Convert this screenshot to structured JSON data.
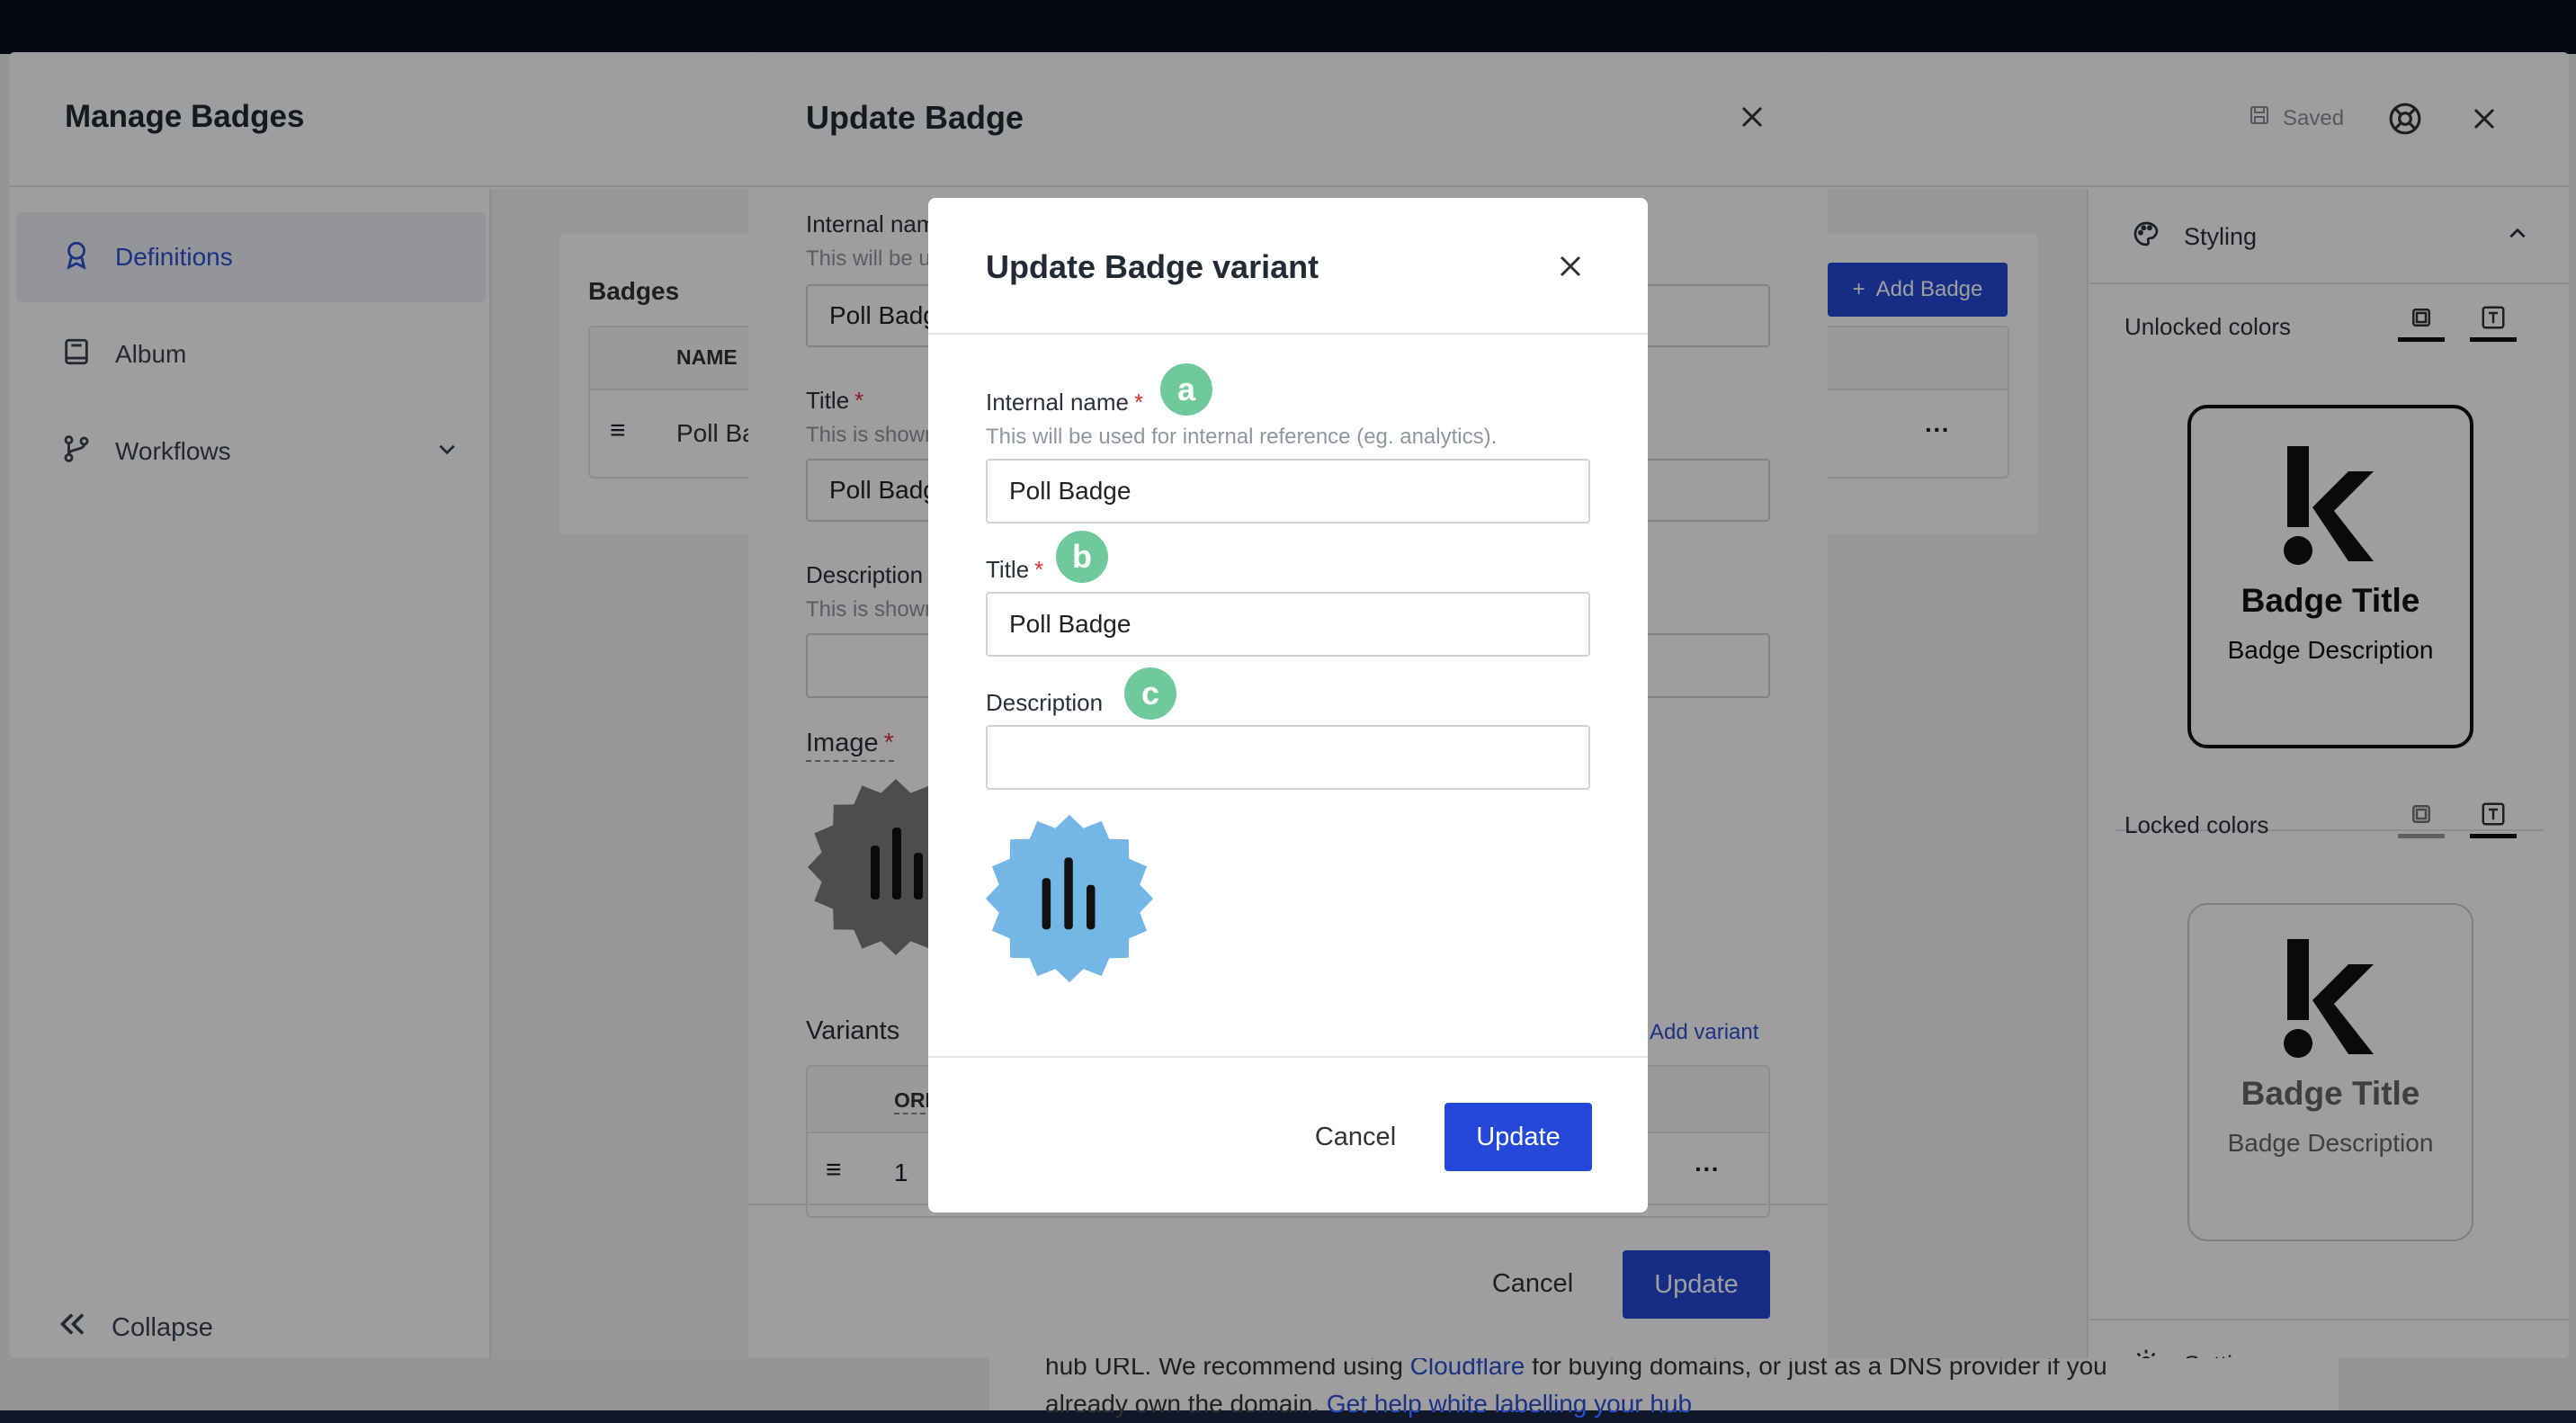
{
  "background": {
    "doc_line1_prefix": "hub URL. We recommend using ",
    "doc_link1": "Cloudflare",
    "doc_line1_suffix": " for buying domains, or just as a DNS provider if you",
    "doc_line2_prefix": "already own the domain. ",
    "doc_link2": "Get help white labelling your hub"
  },
  "manage": {
    "title": "Manage Badges",
    "saved_label": "Saved",
    "sidebar": {
      "items": [
        {
          "label": "Definitions",
          "icon": "badge-icon",
          "active": true
        },
        {
          "label": "Album",
          "icon": "book-icon",
          "active": false
        },
        {
          "label": "Workflows",
          "icon": "workflow-icon",
          "active": false
        }
      ],
      "collapse_label": "Collapse"
    },
    "badges_card": {
      "title": "Badges",
      "add_label": "Add Badge",
      "col_name": "NAME",
      "row_name": "Poll Badge",
      "row_more": "···"
    },
    "right_panel": {
      "styling_label": "Styling",
      "unlocked_label": "Unlocked colors",
      "locked_label": "Locked colors",
      "settings_label": "Settings",
      "preview_title": "Badge Title",
      "preview_desc": "Badge Description"
    }
  },
  "update_badge": {
    "title": "Update Badge",
    "internal_name_label": "Internal name",
    "internal_name_hint": "This will be used for internal reference (eg. analytics).",
    "internal_name_value": "Poll Badge",
    "title_label": "Title",
    "title_hint": "This is shown to users.",
    "title_value": "Poll Badge",
    "description_label": "Description",
    "description_hint": "This is shown to users.",
    "image_label": "Image",
    "variants_label": "Variants",
    "add_variant_label": "Add variant",
    "col_order": "ORDER",
    "row_order": "1",
    "row_more": "···",
    "cancel_label": "Cancel",
    "update_label": "Update"
  },
  "update_variant": {
    "title": "Update Badge variant",
    "internal_name_label": "Internal name",
    "internal_name_hint": "This will be used for internal reference (eg. analytics).",
    "internal_name_value": "Poll Badge",
    "title_label": "Title",
    "title_value": "Poll Badge",
    "description_label": "Description",
    "description_value": "",
    "cancel_label": "Cancel",
    "update_label": "Update",
    "badge_color": "#74b6e6"
  },
  "markers": {
    "a": "a",
    "b": "b",
    "c": "c"
  },
  "colors": {
    "primary": "#2449d8",
    "marker": "#6fc99a",
    "overlay": "rgba(0,0,0,0.38)"
  }
}
